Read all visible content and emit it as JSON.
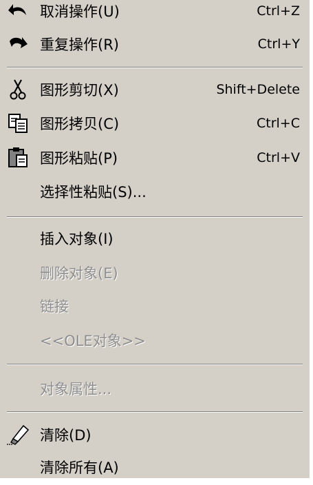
{
  "menu": {
    "items": [
      {
        "id": "undo",
        "label": "取消操作(U)",
        "shortcut": "Ctrl+Z",
        "icon": "undo-arrow-icon",
        "enabled": true
      },
      {
        "id": "redo",
        "label": "重复操作(R)",
        "shortcut": "Ctrl+Y",
        "icon": "redo-arrow-icon",
        "enabled": true
      },
      {
        "id": "cut",
        "label": "图形剪切(X)",
        "shortcut": "Shift+Delete",
        "icon": "scissors-icon",
        "enabled": true
      },
      {
        "id": "copy",
        "label": "图形拷贝(C)",
        "shortcut": "Ctrl+C",
        "icon": "copy-icon",
        "enabled": true
      },
      {
        "id": "paste",
        "label": "图形粘贴(P)",
        "shortcut": "Ctrl+V",
        "icon": "clipboard-icon",
        "enabled": true
      },
      {
        "id": "paste-special",
        "label": "选择性粘贴(S)...",
        "shortcut": "",
        "icon": "",
        "enabled": true
      },
      {
        "id": "insert-object",
        "label": "插入对象(I)",
        "shortcut": "",
        "icon": "",
        "enabled": true
      },
      {
        "id": "delete-object",
        "label": "删除对象(E)",
        "shortcut": "",
        "icon": "",
        "enabled": false
      },
      {
        "id": "link",
        "label": "链接",
        "shortcut": "",
        "icon": "",
        "enabled": false
      },
      {
        "id": "ole-object",
        "label": "<<OLE对象>>",
        "shortcut": "",
        "icon": "",
        "enabled": false
      },
      {
        "id": "object-properties",
        "label": "对象属性...",
        "shortcut": "",
        "icon": "",
        "enabled": false
      },
      {
        "id": "clear",
        "label": "清除(D)",
        "shortcut": "",
        "icon": "eraser-icon",
        "enabled": true
      },
      {
        "id": "clear-all",
        "label": "清除所有(A)",
        "shortcut": "",
        "icon": "",
        "enabled": true
      }
    ]
  },
  "colors": {
    "menu_background": "#d4d0c8",
    "text": "#000000",
    "disabled_text": "#8e8e8e",
    "separator_dark": "#808080",
    "separator_light": "#ffffff"
  }
}
